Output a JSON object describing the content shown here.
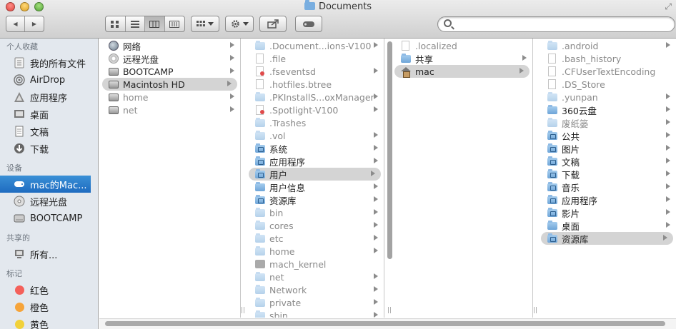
{
  "window": {
    "title": "Documents",
    "resize_glyph": "⤢"
  },
  "toolbar": {
    "nav_back_icon": "◀",
    "nav_forward_icon": "▶",
    "view_modes": [
      "icon-view",
      "list-view",
      "column-view",
      "coverflow-view"
    ],
    "active_view": "column-view",
    "arrange_icon": "grid-icon",
    "action_icon": "gear-icon",
    "share_icon": "share-icon",
    "tag_icon": "tag-icon",
    "search_placeholder": ""
  },
  "sidebar": {
    "favorites_header": "个人收藏",
    "favorites": [
      {
        "label": "我的所有文件",
        "icon": "all-files-icon"
      },
      {
        "label": "AirDrop",
        "icon": "airdrop-icon"
      },
      {
        "label": "应用程序",
        "icon": "applications-icon"
      },
      {
        "label": "桌面",
        "icon": "desktop-icon"
      },
      {
        "label": "文稿",
        "icon": "documents-icon"
      },
      {
        "label": "下载",
        "icon": "downloads-icon"
      }
    ],
    "devices_header": "设备",
    "devices": [
      {
        "label": "mac的Mac...",
        "icon": "hard-drive-icon",
        "selected": true
      },
      {
        "label": "远程光盘",
        "icon": "optical-disc-icon"
      },
      {
        "label": "BOOTCAMP",
        "icon": "disk-icon"
      }
    ],
    "shared_header": "共享的",
    "shared": [
      {
        "label": "所有...",
        "icon": "network-icon"
      }
    ],
    "tags_header": "标记",
    "tags": [
      {
        "label": "红色",
        "color": "#f4605a"
      },
      {
        "label": "橙色",
        "color": "#f6a43a"
      },
      {
        "label": "黄色",
        "color": "#f1d13a"
      }
    ]
  },
  "columns": [
    {
      "items": [
        {
          "label": "网络",
          "icon": "globe",
          "chevron": true
        },
        {
          "label": "远程光盘",
          "icon": "cd",
          "chevron": true
        },
        {
          "label": "BOOTCAMP",
          "icon": "disk",
          "chevron": true
        },
        {
          "label": "Macintosh HD",
          "icon": "disk",
          "chevron": true,
          "selected": true
        },
        {
          "label": "home",
          "icon": "disk",
          "chevron": true,
          "dim": true
        },
        {
          "label": "net",
          "icon": "disk",
          "chevron": true,
          "dim": true
        }
      ]
    },
    {
      "items": [
        {
          "label": ".Document...ions-V100",
          "icon": "folder-dim",
          "chevron": true,
          "dim": true
        },
        {
          "label": ".file",
          "icon": "doc",
          "dim": true
        },
        {
          "label": ".fseventsd",
          "icon": "doc-red",
          "chevron": true,
          "dim": true
        },
        {
          "label": ".hotfiles.btree",
          "icon": "doc",
          "dim": true
        },
        {
          "label": ".PKInstallS...oxManager",
          "icon": "folder-dim",
          "chevron": true,
          "dim": true
        },
        {
          "label": ".Spotlight-V100",
          "icon": "doc-red",
          "chevron": true,
          "dim": true
        },
        {
          "label": ".Trashes",
          "icon": "folder-dim",
          "dim": true
        },
        {
          "label": ".vol",
          "icon": "folder-dim",
          "chevron": true,
          "dim": true
        },
        {
          "label": "系统",
          "icon": "folder-badge",
          "chevron": true
        },
        {
          "label": "应用程序",
          "icon": "folder-badge",
          "chevron": true
        },
        {
          "label": "用户",
          "icon": "folder-badge",
          "chevron": true,
          "selected": true
        },
        {
          "label": "用户信息",
          "icon": "folder",
          "chevron": true
        },
        {
          "label": "资源库",
          "icon": "folder-badge",
          "chevron": true
        },
        {
          "label": "bin",
          "icon": "folder-dim",
          "chevron": true,
          "dim": true
        },
        {
          "label": "cores",
          "icon": "folder-dim",
          "chevron": true,
          "dim": true
        },
        {
          "label": "etc",
          "icon": "folder-dim",
          "chevron": true,
          "dim": true
        },
        {
          "label": "home",
          "icon": "folder-dim",
          "chevron": true,
          "dim": true
        },
        {
          "label": "mach_kernel",
          "icon": "gray",
          "dim": true
        },
        {
          "label": "net",
          "icon": "folder-dim",
          "chevron": true,
          "dim": true
        },
        {
          "label": "Network",
          "icon": "folder-dim",
          "chevron": true,
          "dim": true
        },
        {
          "label": "private",
          "icon": "folder-dim",
          "chevron": true,
          "dim": true
        },
        {
          "label": "sbin",
          "icon": "folder-dim",
          "chevron": true,
          "dim": true
        }
      ]
    },
    {
      "items": [
        {
          "label": ".localized",
          "icon": "doc",
          "dim": true
        },
        {
          "label": "共享",
          "icon": "folder",
          "chevron": true
        },
        {
          "label": "mac",
          "icon": "house",
          "chevron": true,
          "selected": true
        }
      ]
    },
    {
      "items": [
        {
          "label": ".android",
          "icon": "folder-dim",
          "chevron": true,
          "dim": true
        },
        {
          "label": ".bash_history",
          "icon": "doc",
          "dim": true
        },
        {
          "label": ".CFUserTextEncoding",
          "icon": "doc",
          "dim": true
        },
        {
          "label": ".DS_Store",
          "icon": "doc",
          "dim": true
        },
        {
          "label": ".yunpan",
          "icon": "folder-dim",
          "chevron": true,
          "dim": true
        },
        {
          "label": "360云盘",
          "icon": "folder",
          "chevron": true
        },
        {
          "label": "废纸篓",
          "icon": "folder-dim",
          "chevron": true,
          "dim": true
        },
        {
          "label": "公共",
          "icon": "folder-badge",
          "chevron": true
        },
        {
          "label": "图片",
          "icon": "folder-badge",
          "chevron": true
        },
        {
          "label": "文稿",
          "icon": "folder-badge",
          "chevron": true
        },
        {
          "label": "下载",
          "icon": "folder-badge",
          "chevron": true
        },
        {
          "label": "音乐",
          "icon": "folder-badge",
          "chevron": true
        },
        {
          "label": "应用程序",
          "icon": "folder-badge",
          "chevron": true
        },
        {
          "label": "影片",
          "icon": "folder-badge",
          "chevron": true
        },
        {
          "label": "桌面",
          "icon": "folder",
          "chevron": true
        },
        {
          "label": "资源库",
          "icon": "folder-badge",
          "chevron": true,
          "selected": true
        }
      ]
    }
  ]
}
